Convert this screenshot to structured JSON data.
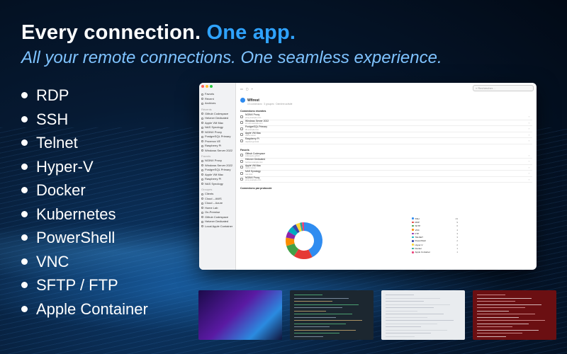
{
  "hero": {
    "headline_part1": "Every connection.",
    "headline_part2": "One app.",
    "subline": "All your remote connections. One seamless experience."
  },
  "features": [
    "RDP",
    "SSH",
    "Telnet",
    "Hyper-V",
    "Docker",
    "Kubernetes",
    "PowerShell",
    "VNC",
    "SFTP / FTP",
    "Apple Container"
  ],
  "colors": {
    "accent": "#2fa3ff",
    "subline": "#7fc3ff"
  },
  "app": {
    "search_placeholder": "Rechercher…",
    "sidebar": {
      "top": [
        "Favoris",
        "Récent",
        "Archives"
      ],
      "section1_title": "Récents",
      "section1": [
        "Github Codespace",
        "Hetzner Dedicated",
        "Apple VM Mac",
        "NAS Synology",
        "NGINX Proxy",
        "PostgreSQL Primary",
        "Proxmox VE",
        "Raspberry Pi",
        "Windows Server 2022"
      ],
      "section2_title": "Favoris",
      "section2": [
        "NGINX Proxy",
        "Windows Server 2022",
        "PostgreSQL Primary",
        "Apple VM Mac",
        "Raspberry Pi",
        "NAS Synology"
      ],
      "section3_title": "Groupes",
      "section3": [
        "Clients",
        "Cloud – AWS",
        "Cloud – Azure",
        "Home Lab",
        "On-Premise",
        "Github Codespace",
        "Hetzner Dedicated",
        "Local Apple Container"
      ]
    },
    "host": {
      "title": "Wfirest",
      "subtitle": "10 connexions · 3 groupes · Dernière activité"
    },
    "recent_title": "Connexions récentes",
    "recent": [
      {
        "name": "NGINX Proxy",
        "sub": "proxy.example.com"
      },
      {
        "name": "Windows Server 2022",
        "sub": "srv-win.example.com"
      },
      {
        "name": "PostgreSQL Primary",
        "sub": "db.example.com"
      },
      {
        "name": "Apple VM Mac",
        "sub": "macvm.local"
      },
      {
        "name": "Raspberry Pi",
        "sub": "raspberrypi.local"
      }
    ],
    "fav_title": "Favoris",
    "favs": [
      {
        "name": "Github Codespace",
        "sub": "codespace.github"
      },
      {
        "name": "Hetzner Dedicated",
        "sub": "hetzner.example.com"
      },
      {
        "name": "Apple VM Mac",
        "sub": "macvm.local"
      },
      {
        "name": "NAS Synology",
        "sub": "nas.local"
      },
      {
        "name": "NGINX Proxy",
        "sub": "proxy.example.com"
      }
    ],
    "chart_title": "Connexions par protocole",
    "protocols": [
      {
        "name": "SSH",
        "count": "23",
        "color": "#2f8cf0"
      },
      {
        "name": "RDP",
        "count": "9",
        "color": "#e53935"
      },
      {
        "name": "SFTP",
        "count": "6",
        "color": "#43a047"
      },
      {
        "name": "VNC",
        "count": "4",
        "color": "#fb8c00"
      },
      {
        "name": "FTP",
        "count": "3",
        "color": "#8e24aa"
      },
      {
        "name": "TELNET",
        "count": "3",
        "color": "#00acc1"
      },
      {
        "name": "PowerShell",
        "count": "2",
        "color": "#3949ab"
      },
      {
        "name": "Hyper-V",
        "count": "2",
        "color": "#fdd835"
      },
      {
        "name": "Docker",
        "count": "1",
        "color": "#26a69a"
      },
      {
        "name": "Apple Container",
        "count": "1",
        "color": "#ec407a"
      }
    ]
  }
}
